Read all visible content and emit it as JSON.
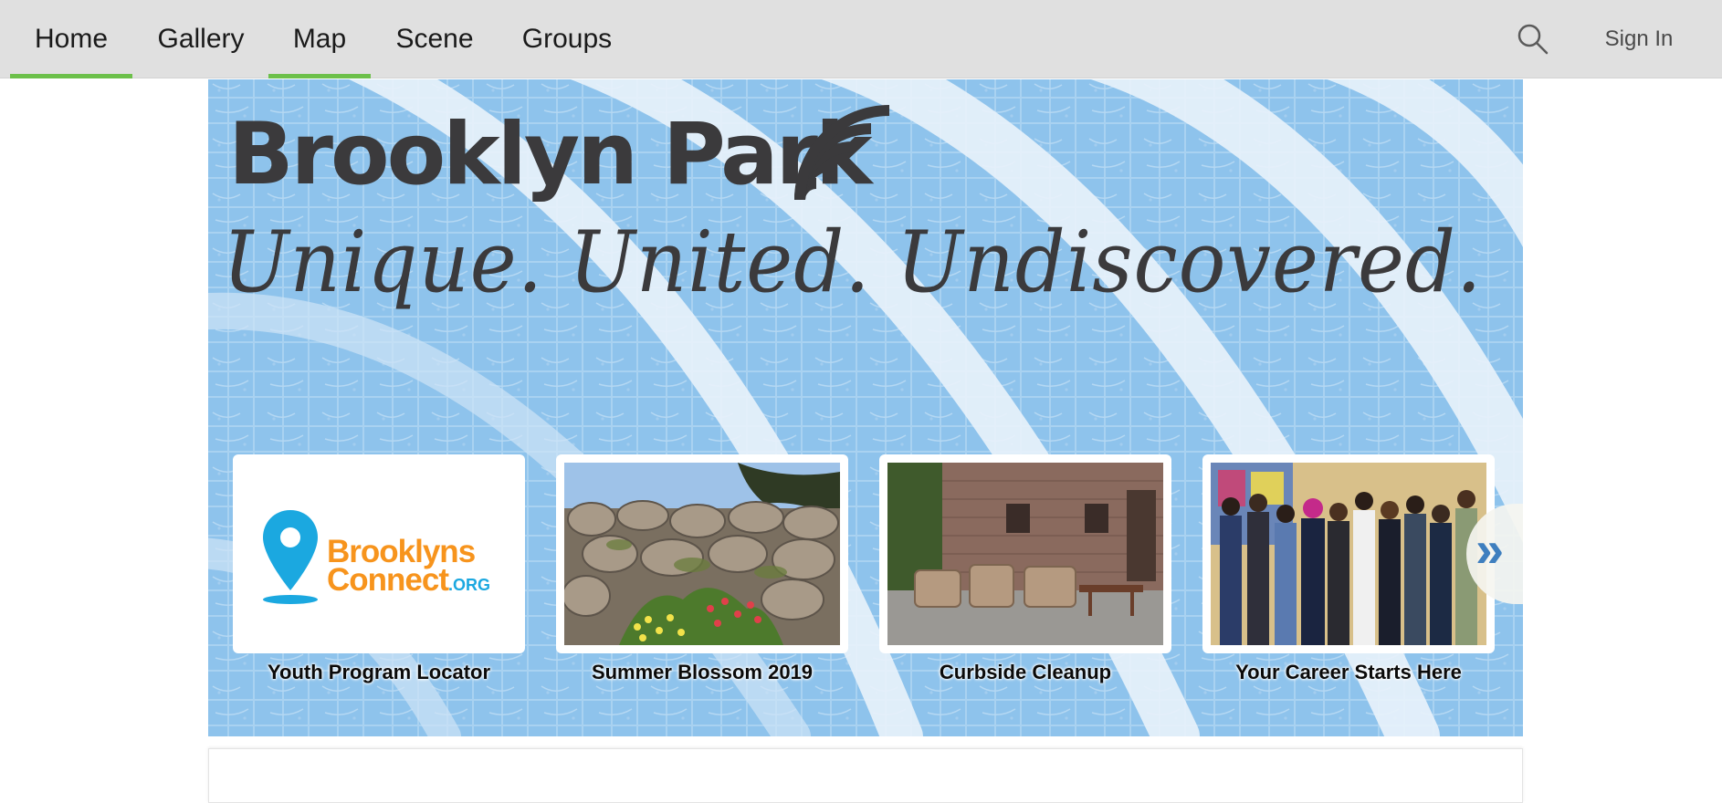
{
  "nav": {
    "items": [
      {
        "label": "Home",
        "active": true
      },
      {
        "label": "Gallery",
        "active": false
      },
      {
        "label": "Map",
        "active": true
      },
      {
        "label": "Scene",
        "active": false
      },
      {
        "label": "Groups",
        "active": false
      }
    ],
    "search_icon": "search-icon",
    "signin_label": "Sign In",
    "active_color": "#6cc04a",
    "bar_color": "#e0e0e0"
  },
  "banner": {
    "title": "Brooklyn Park",
    "tagline": "Unique. United. Undiscovered.",
    "background_color": "#8ec3ec",
    "text_color": "#3b3a3c"
  },
  "cards": [
    {
      "caption": "Youth Program Locator",
      "logo_line1": "Brooklyns",
      "logo_line2": "Connect",
      "logo_suffix": ".ORG"
    },
    {
      "caption": "Summer Blossom 2019"
    },
    {
      "caption": "Curbside Cleanup"
    },
    {
      "caption": "Your Career Starts Here"
    }
  ],
  "carousel": {
    "next_icon": "double-chevron-right-icon",
    "next_glyph": "»"
  }
}
